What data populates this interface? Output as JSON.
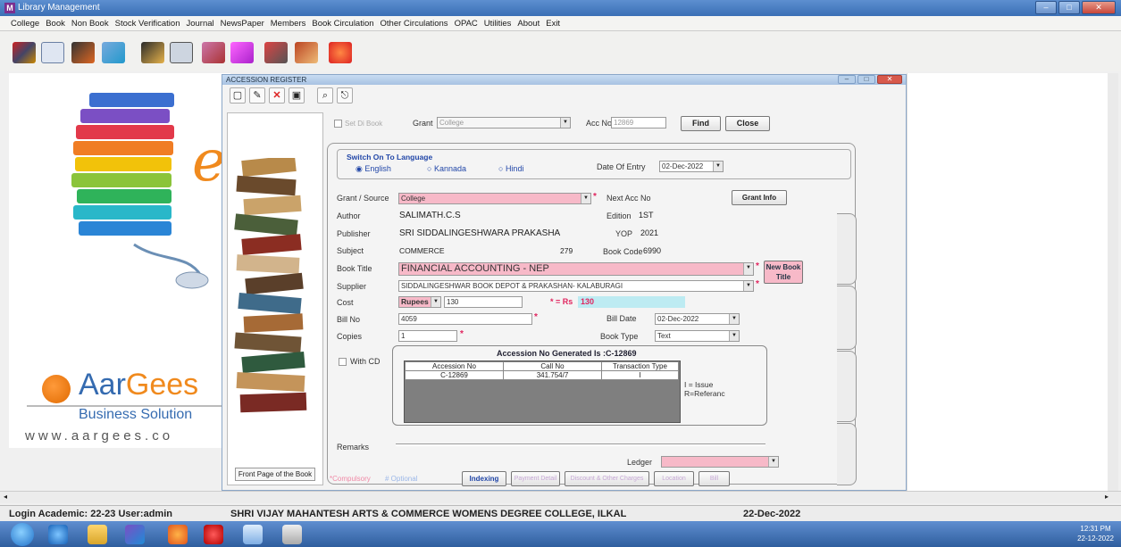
{
  "app": {
    "title": "Library Management"
  },
  "menu": [
    "College",
    "Book",
    "Non Book",
    "Stock Verification",
    "Journal",
    "NewsPaper",
    "Members",
    "Book Circulation",
    "Other Circulations",
    "OPAC",
    "Utilities",
    "About",
    "Exit"
  ],
  "brand": {
    "letter": "e",
    "name_a": "Ar",
    "name_b": "Gees",
    "name_full_a": "Aar",
    "subtitle": "Business Solution",
    "url": "www.aargees.co"
  },
  "child": {
    "title": "ACCESSION REGISTER",
    "set_di_book": "Set Di Book",
    "grant_label": "Grant",
    "grant_value": "College",
    "acc_no_label": "Acc No",
    "acc_no_value": "12869",
    "find_label": "Find",
    "close_label": "Close",
    "front_page_caption": "Front Page of the Book",
    "language": {
      "heading": "Switch On To Language",
      "options": [
        "English",
        "Kannada",
        "Hindi"
      ],
      "selected": "English"
    },
    "date_of_entry_label": "Date Of Entry",
    "date_of_entry_value": "02-Dec-2022",
    "grant_source_label": "Grant / Source",
    "grant_source_value": "College",
    "next_acc_no_label": "Next Acc No",
    "grant_info_label": "Grant Info",
    "author_label": "Author",
    "author_value": "SALIMATH.C.S",
    "edition_label": "Edition",
    "edition_value": "1ST",
    "publisher_label": "Publisher",
    "publisher_value": "SRI SIDDALINGESHWARA PRAKASHA",
    "yop_label": "YOP",
    "yop_value": "2021",
    "subject_label": "Subject",
    "subject_value": "COMMERCE",
    "subject_code": "279",
    "book_code_label": "Book Code",
    "book_code_value": "6990",
    "book_title_label": "Book Title",
    "book_title_value": "FINANCIAL ACCOUNTING  -  NEP",
    "new_book_title_label": "New Book Title",
    "supplier_label": "Supplier",
    "supplier_value": "SIDDALINGESHWAR BOOK DEPOT & PRAKASHAN- KALABURAGI",
    "cost_label": "Cost",
    "cost_currency": "Rupees",
    "cost_value": "130",
    "rs_label": "* =  Rs",
    "rs_value": "130",
    "bill_no_label": "Bill No",
    "bill_no_value": "4059",
    "bill_date_label": "Bill Date",
    "bill_date_value": "02-Dec-2022",
    "copies_label": "Copies",
    "copies_value": "1",
    "book_type_label": "Book Type",
    "book_type_value": "Text",
    "with_cd_label": "With CD",
    "acc_generated": "Accession No Generated Is :C-12869",
    "grid_headers": [
      "Accession No",
      "Call No",
      "Transaction Type"
    ],
    "grid_rows": [
      [
        "C-12869",
        "341.754/7",
        "I"
      ]
    ],
    "legend_issue": "I = Issue",
    "legend_ref": "R=Referanc",
    "remarks_label": "Remarks",
    "ledger_label": "Ledger",
    "compulsory": "*Compulsory",
    "optional": "# Optional",
    "bottom_buttons": [
      "Indexing",
      "Payment Detail",
      "Discount & Other Charges",
      "Location",
      "Bill"
    ]
  },
  "status": {
    "login": "Login Academic: 22-23  User:admin",
    "college": "SHRI VIJAY MAHANTESH ARTS & COMMERCE WOMENS DEGREE COLLEGE, ILKAL",
    "date": "22-Dec-2022"
  },
  "clock": {
    "time": "12:31 PM",
    "date": "22-12-2022"
  }
}
